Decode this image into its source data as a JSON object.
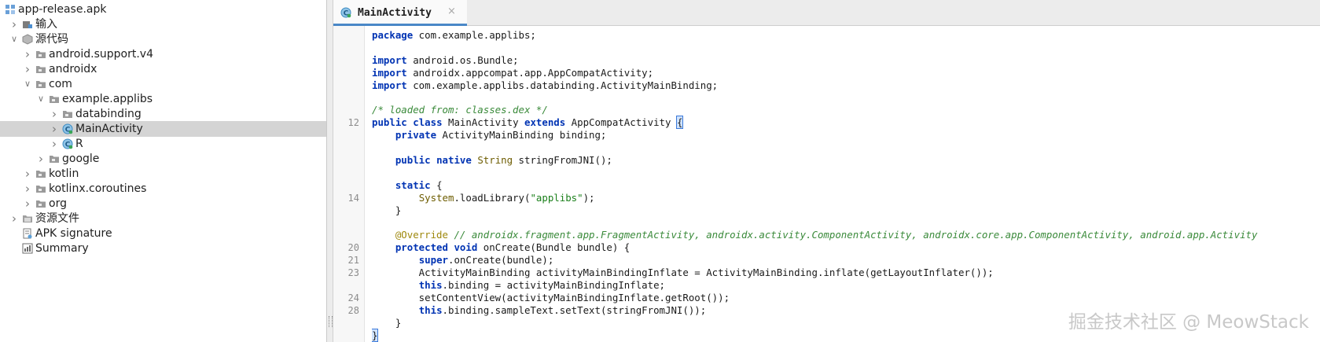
{
  "tree": {
    "items": [
      {
        "label": "app-release.apk",
        "icon": "apk-icon",
        "depth": 0,
        "expander": "none",
        "selected": false
      },
      {
        "label": "输入",
        "icon": "input-icon",
        "depth": 1,
        "expander": "collapsed",
        "selected": false
      },
      {
        "label": "源代码",
        "icon": "source-icon",
        "depth": 1,
        "expander": "expanded",
        "selected": false
      },
      {
        "label": "android.support.v4",
        "icon": "package-icon",
        "depth": 2,
        "expander": "collapsed",
        "selected": false
      },
      {
        "label": "androidx",
        "icon": "package-icon",
        "depth": 2,
        "expander": "collapsed",
        "selected": false
      },
      {
        "label": "com",
        "icon": "package-icon",
        "depth": 2,
        "expander": "expanded",
        "selected": false
      },
      {
        "label": "example.applibs",
        "icon": "package-icon",
        "depth": 3,
        "expander": "expanded",
        "selected": false
      },
      {
        "label": "databinding",
        "icon": "package-icon",
        "depth": 4,
        "expander": "collapsed",
        "selected": false
      },
      {
        "label": "MainActivity",
        "icon": "class-icon",
        "depth": 4,
        "expander": "collapsed",
        "selected": true
      },
      {
        "label": "R",
        "icon": "class-icon",
        "depth": 4,
        "expander": "collapsed",
        "selected": false
      },
      {
        "label": "google",
        "icon": "package-icon",
        "depth": 3,
        "expander": "collapsed",
        "selected": false
      },
      {
        "label": "kotlin",
        "icon": "package-icon",
        "depth": 2,
        "expander": "collapsed",
        "selected": false
      },
      {
        "label": "kotlinx.coroutines",
        "icon": "package-icon",
        "depth": 2,
        "expander": "collapsed",
        "selected": false
      },
      {
        "label": "org",
        "icon": "package-icon",
        "depth": 2,
        "expander": "collapsed",
        "selected": false
      },
      {
        "label": "资源文件",
        "icon": "resources-icon",
        "depth": 1,
        "expander": "collapsed",
        "selected": false
      },
      {
        "label": "APK signature",
        "icon": "signature-icon",
        "depth": 1,
        "expander": "none",
        "selected": false
      },
      {
        "label": "Summary",
        "icon": "summary-icon",
        "depth": 1,
        "expander": "none",
        "selected": false
      }
    ]
  },
  "tabs": [
    {
      "label": "MainActivity",
      "close_label": "×",
      "icon": "class-icon"
    }
  ],
  "gutter": {
    "numbers": [
      {
        "line_index": 7,
        "label": "12"
      },
      {
        "line_index": 13,
        "label": "14"
      },
      {
        "line_index": 17,
        "label": "20"
      },
      {
        "line_index": 18,
        "label": "21"
      },
      {
        "line_index": 19,
        "label": "23"
      },
      {
        "line_index": 21,
        "label": "24"
      },
      {
        "line_index": 22,
        "label": "28"
      }
    ]
  },
  "code": {
    "lines": [
      [
        {
          "t": "package",
          "c": "kw"
        },
        {
          "t": " com.example.applibs;"
        }
      ],
      [],
      [
        {
          "t": "import",
          "c": "kw"
        },
        {
          "t": " android.os.Bundle;"
        }
      ],
      [
        {
          "t": "import",
          "c": "kw"
        },
        {
          "t": " androidx.appcompat.app.AppCompatActivity;"
        }
      ],
      [
        {
          "t": "import",
          "c": "kw"
        },
        {
          "t": " com.example.applibs.databinding.ActivityMainBinding;"
        }
      ],
      [],
      [
        {
          "t": "/* loaded from: classes.dex */",
          "c": "cm"
        }
      ],
      [
        {
          "t": "public",
          "c": "kw"
        },
        {
          "t": " "
        },
        {
          "t": "class",
          "c": "kw"
        },
        {
          "t": " MainActivity "
        },
        {
          "t": "extends",
          "c": "kw"
        },
        {
          "t": " AppCompatActivity "
        },
        {
          "t": "{",
          "c": "brace"
        }
      ],
      [
        {
          "t": "    "
        },
        {
          "t": "private",
          "c": "kw"
        },
        {
          "t": " ActivityMainBinding binding;"
        }
      ],
      [],
      [
        {
          "t": "    "
        },
        {
          "t": "public",
          "c": "kw"
        },
        {
          "t": " "
        },
        {
          "t": "native",
          "c": "kw"
        },
        {
          "t": " "
        },
        {
          "t": "String",
          "c": "cls"
        },
        {
          "t": " stringFromJNI();"
        }
      ],
      [],
      [
        {
          "t": "    "
        },
        {
          "t": "static",
          "c": "kw"
        },
        {
          "t": " {"
        }
      ],
      [
        {
          "t": "        "
        },
        {
          "t": "System",
          "c": "cls"
        },
        {
          "t": ".loadLibrary("
        },
        {
          "t": "\"applibs\"",
          "c": "str"
        },
        {
          "t": ");"
        }
      ],
      [
        {
          "t": "    }"
        }
      ],
      [],
      [
        {
          "t": "    "
        },
        {
          "t": "@Override",
          "c": "an"
        },
        {
          "t": " "
        },
        {
          "t": "// androidx.fragment.app.FragmentActivity, androidx.activity.ComponentActivity, androidx.core.app.ComponentActivity, android.app.Activity",
          "c": "cm"
        }
      ],
      [
        {
          "t": "    "
        },
        {
          "t": "protected",
          "c": "kw"
        },
        {
          "t": " "
        },
        {
          "t": "void",
          "c": "kw"
        },
        {
          "t": " onCreate(Bundle bundle) {"
        }
      ],
      [
        {
          "t": "        "
        },
        {
          "t": "super",
          "c": "kw"
        },
        {
          "t": ".onCreate(bundle);"
        }
      ],
      [
        {
          "t": "        ActivityMainBinding activityMainBindingInflate = ActivityMainBinding.inflate(getLayoutInflater());"
        }
      ],
      [
        {
          "t": "        "
        },
        {
          "t": "this",
          "c": "kw"
        },
        {
          "t": ".binding = activityMainBindingInflate;"
        }
      ],
      [
        {
          "t": "        setContentView(activityMainBindingInflate.getRoot());"
        }
      ],
      [
        {
          "t": "        "
        },
        {
          "t": "this",
          "c": "kw"
        },
        {
          "t": ".binding.sampleText.setText(stringFromJNI());"
        }
      ],
      [
        {
          "t": "    }"
        }
      ],
      [
        {
          "t": "}",
          "c": "brace"
        }
      ]
    ]
  },
  "watermark": {
    "text": "掘金技术社区 @ MeowStack"
  },
  "colors": {
    "accent": "#4a88c7",
    "selection": "#d4d4d4",
    "keyword": "#0033b3",
    "comment": "#3a8a3a"
  }
}
